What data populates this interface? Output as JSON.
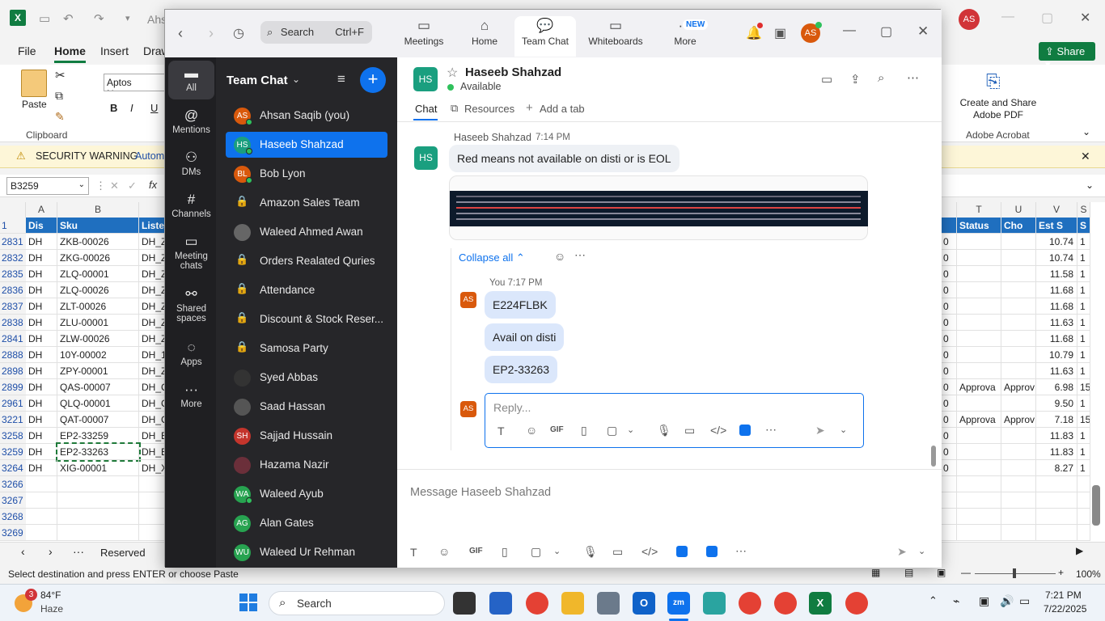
{
  "excel": {
    "app_icon": "X",
    "title_fragment": "Ahs",
    "avatar": "AS",
    "menu": [
      "File",
      "Home",
      "Insert",
      "Draw"
    ],
    "active_menu": "Home",
    "share_label": "Share",
    "font_name": "Aptos Narrow",
    "paste_label": "Paste",
    "clipboard_label": "Clipboard",
    "adobe_create": "Create and Share Adobe PDF",
    "adobe_group": "Adobe Acrobat",
    "security_warning": "SECURITY WARNING",
    "security_detail": "Autom",
    "namebox": "B3259",
    "fx": "fx",
    "columns_left": [
      "A",
      "B"
    ],
    "columns_right": [
      "T",
      "U",
      "V",
      "S"
    ],
    "headers_left": [
      "Dis",
      "Sku",
      "Liste"
    ],
    "headers_right": [
      "Status",
      "Cho",
      "Est S",
      "S"
    ],
    "rows": [
      {
        "n": "2831",
        "a": "DH",
        "b": "ZKB-00026",
        "c": "DH_Z",
        "r0": "0",
        "t": "",
        "u": "",
        "v": "10.74"
      },
      {
        "n": "2832",
        "a": "DH",
        "b": "ZKG-00026",
        "c": "DH_Z",
        "r0": "0",
        "t": "",
        "u": "",
        "v": "10.74"
      },
      {
        "n": "2835",
        "a": "DH",
        "b": "ZLQ-00001",
        "c": "DH_Z",
        "r0": "0",
        "t": "",
        "u": "",
        "v": "11.58"
      },
      {
        "n": "2836",
        "a": "DH",
        "b": "ZLQ-00026",
        "c": "DH_Z",
        "r0": "0",
        "t": "",
        "u": "",
        "v": "11.68"
      },
      {
        "n": "2837",
        "a": "DH",
        "b": "ZLT-00026",
        "c": "DH_Z",
        "r0": "0",
        "t": "",
        "u": "",
        "v": "11.68"
      },
      {
        "n": "2838",
        "a": "DH",
        "b": "ZLU-00001",
        "c": "DH_Z",
        "r0": "0",
        "t": "",
        "u": "",
        "v": "11.63"
      },
      {
        "n": "2841",
        "a": "DH",
        "b": "ZLW-00026",
        "c": "DH_Z",
        "r0": "0",
        "t": "",
        "u": "",
        "v": "11.68"
      },
      {
        "n": "2888",
        "a": "DH",
        "b": "10Y-00002",
        "c": "DH_1",
        "r0": "0",
        "t": "",
        "u": "",
        "v": "10.79"
      },
      {
        "n": "2898",
        "a": "DH",
        "b": "ZPY-00001",
        "c": "DH_Z",
        "r0": "0",
        "t": "",
        "u": "",
        "v": "11.63"
      },
      {
        "n": "2899",
        "a": "DH",
        "b": "QAS-00007",
        "c": "DH_C",
        "r0": "0",
        "t": "Approva",
        "u": "Approv",
        "v": "6.98"
      },
      {
        "n": "2961",
        "a": "DH",
        "b": "QLQ-00001",
        "c": "DH_C",
        "r0": "0",
        "t": "",
        "u": "",
        "v": "9.50"
      },
      {
        "n": "3221",
        "a": "DH",
        "b": "QAT-00007",
        "c": "DH_C",
        "r0": "0",
        "t": "Approva",
        "u": "Approv",
        "v": "7.18"
      },
      {
        "n": "3258",
        "a": "DH",
        "b": "EP2-33259",
        "c": "DH_E",
        "r0": "0",
        "t": "",
        "u": "",
        "v": "11.83"
      },
      {
        "n": "3259",
        "a": "DH",
        "b": "EP2-33263",
        "c": "DH_E",
        "r0": "0",
        "t": "",
        "u": "",
        "v": "11.83"
      },
      {
        "n": "3264",
        "a": "DH",
        "b": "XIG-00001",
        "c": "DH_X",
        "r0": "0",
        "t": "",
        "u": "",
        "v": "8.27"
      },
      {
        "n": "3266",
        "a": "",
        "b": "",
        "c": "",
        "r0": "",
        "t": "",
        "u": "",
        "v": ""
      },
      {
        "n": "3267",
        "a": "",
        "b": "",
        "c": "",
        "r0": "",
        "t": "",
        "u": "",
        "v": ""
      },
      {
        "n": "3268",
        "a": "",
        "b": "",
        "c": "",
        "r0": "",
        "t": "",
        "u": "",
        "v": ""
      },
      {
        "n": "3269",
        "a": "",
        "b": "",
        "c": "",
        "r0": "",
        "t": "",
        "u": "",
        "v": ""
      }
    ],
    "right_edge_values": [
      "1",
      "1",
      "1",
      "1",
      "1",
      "1",
      "1",
      "1",
      "1",
      "15",
      "1",
      "15",
      "1",
      "1",
      "1"
    ],
    "sheet_tab": "Reserved",
    "status_text": "Select destination and press ENTER or choose Paste",
    "zoom_level": "100%"
  },
  "zoom": {
    "search_placeholder": "Search",
    "search_shortcut": "Ctrl+F",
    "tabs": [
      {
        "label": "Meetings",
        "icon": "video-icon"
      },
      {
        "label": "Home",
        "icon": "home-icon"
      },
      {
        "label": "Team Chat",
        "icon": "chat-icon"
      },
      {
        "label": "Whiteboards",
        "icon": "whiteboard-icon"
      },
      {
        "label": "More",
        "icon": "more-icon",
        "badge": "NEW"
      }
    ],
    "user_avatar": "AS",
    "rail": [
      {
        "label": "All"
      },
      {
        "label": "Mentions"
      },
      {
        "label": "DMs"
      },
      {
        "label": "Channels"
      },
      {
        "label": "Meeting chats"
      },
      {
        "label": "Shared spaces"
      },
      {
        "label": "Apps"
      },
      {
        "label": "More"
      }
    ],
    "list_title": "Team Chat",
    "channels": [
      {
        "name": "Ahsan Saqib (you)",
        "avatar": "AS",
        "color": "#d9590c",
        "online": true,
        "type": "person"
      },
      {
        "name": "Haseeb Shahzad",
        "avatar": "HS",
        "color": "#1a9f7f",
        "online": true,
        "type": "person",
        "selected": true
      },
      {
        "name": "Bob Lyon",
        "avatar": "BL",
        "color": "#d9590c",
        "online": true,
        "type": "person"
      },
      {
        "name": "Amazon Sales Team",
        "type": "lock"
      },
      {
        "name": "Waleed Ahmed Awan",
        "avatar": "",
        "color": "#666",
        "online": false,
        "type": "photo"
      },
      {
        "name": "Orders Realated Quries",
        "type": "lock"
      },
      {
        "name": "Attendance",
        "type": "lock"
      },
      {
        "name": "Discount & Stock Reser...",
        "type": "lock"
      },
      {
        "name": "Samosa Party",
        "type": "lock"
      },
      {
        "name": "Syed Abbas",
        "avatar": "",
        "color": "#333",
        "online": false,
        "type": "photo"
      },
      {
        "name": "Saad Hassan",
        "avatar": "",
        "color": "#555",
        "online": false,
        "type": "photo"
      },
      {
        "name": "Sajjad Hussain",
        "avatar": "SH",
        "color": "#c4352c",
        "online": false,
        "type": "person"
      },
      {
        "name": "Hazama Nazir",
        "avatar": "",
        "color": "#6b2f3a",
        "online": false,
        "type": "photo"
      },
      {
        "name": "Waleed Ayub",
        "avatar": "WA",
        "color": "#27a350",
        "online": true,
        "type": "person"
      },
      {
        "name": "Alan Gates",
        "avatar": "AG",
        "color": "#27a350",
        "online": false,
        "type": "person"
      },
      {
        "name": "Waleed Ur Rehman",
        "avatar": "WU",
        "color": "#27a350",
        "online": false,
        "type": "person"
      }
    ],
    "chat": {
      "contact_initials": "HS",
      "contact_name": "Haseeb Shahzad",
      "contact_status": "Available",
      "subtabs": [
        "Chat",
        "Resources",
        "Add a tab"
      ],
      "msg1_sender": "Haseeb Shahzad",
      "msg1_time": "7:14 PM",
      "msg1_text": "Red means not available on disti or is EOL",
      "collapse_label": "Collapse all",
      "reply_meta": "You 7:17 PM",
      "reply_avatar": "AS",
      "replies": [
        "E224FLBK",
        "Avail on disti",
        "EP2-33263"
      ],
      "reply_placeholder": "Reply...",
      "message_placeholder": "Message Haseeb Shahzad"
    }
  },
  "taskbar": {
    "weather_badge": "3",
    "temperature": "84°F",
    "weather": "Haze",
    "search": "Search",
    "time": "7:21 PM",
    "date": "7/22/2025"
  }
}
